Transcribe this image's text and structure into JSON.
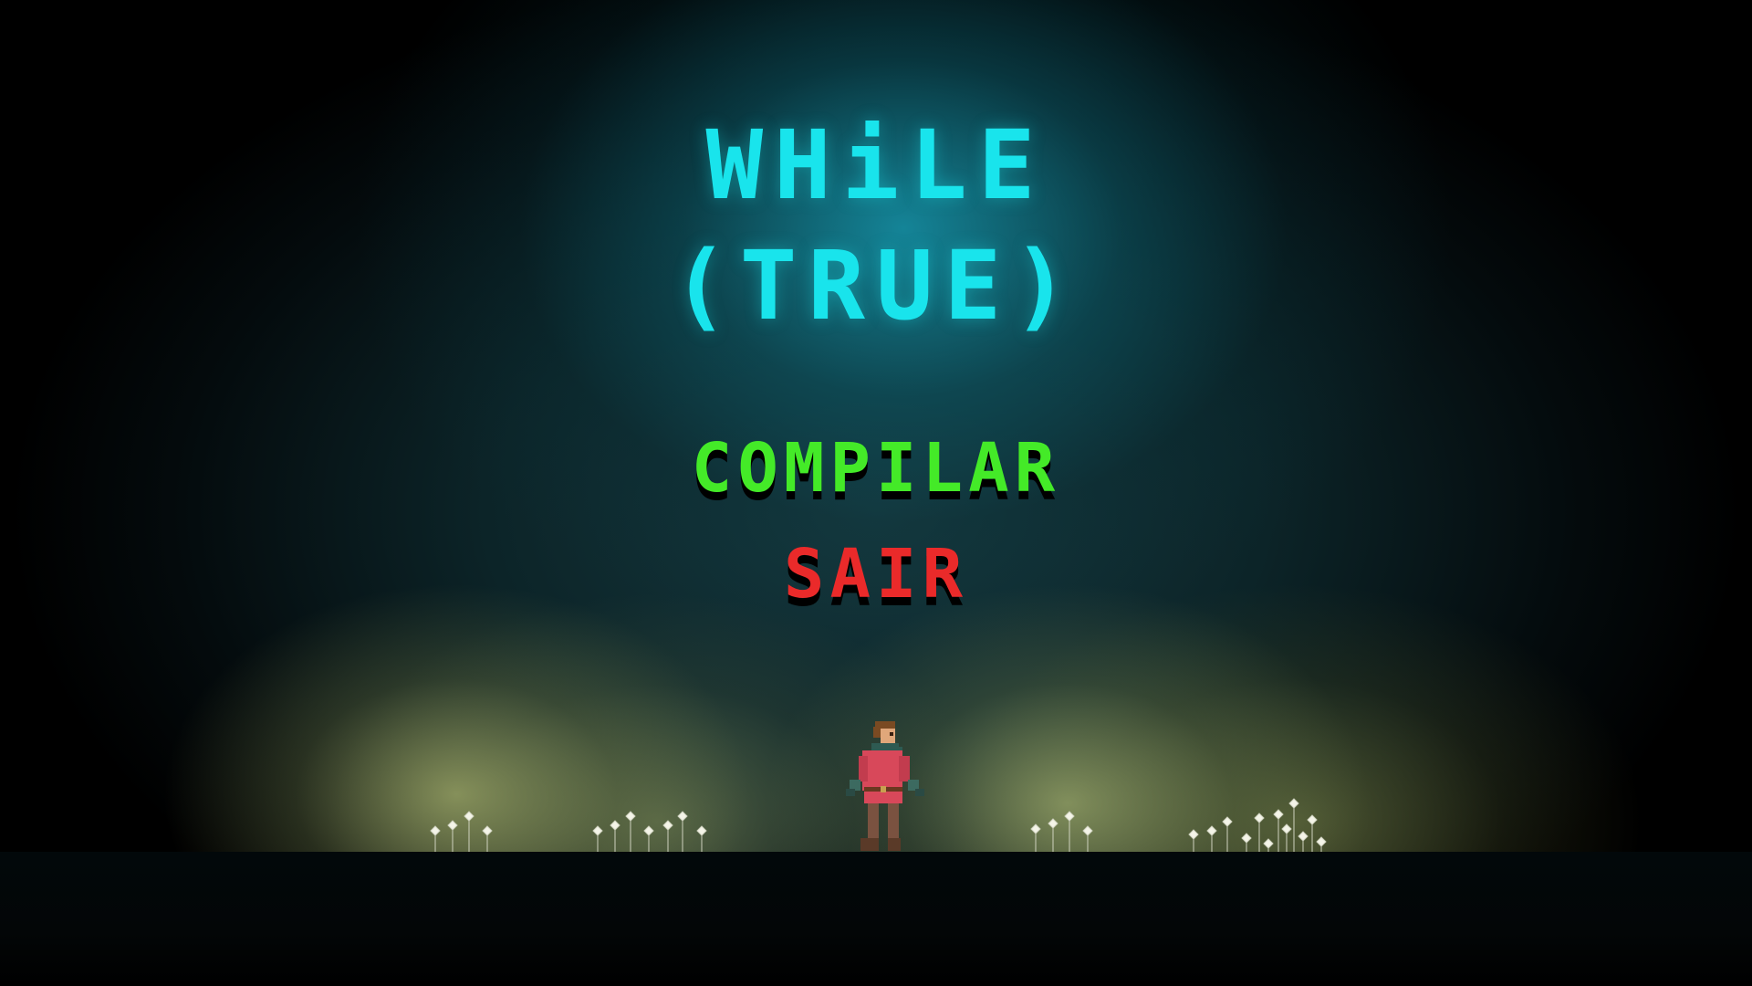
{
  "game": {
    "title_line_1": "WHiLE",
    "title_line_2": "(TRUE)"
  },
  "menu": {
    "options": [
      {
        "label": "COMPILAR",
        "color": "#44ea28"
      },
      {
        "label": "SAIR",
        "color": "#ea2a2a"
      }
    ]
  },
  "colors": {
    "title": "#19e4ec",
    "glow": "#1696ac",
    "flower_light": "#aab46e",
    "ground": "#02080a"
  },
  "scene": {
    "character": "hero-sprite",
    "decoration": "glowing-flowers"
  }
}
